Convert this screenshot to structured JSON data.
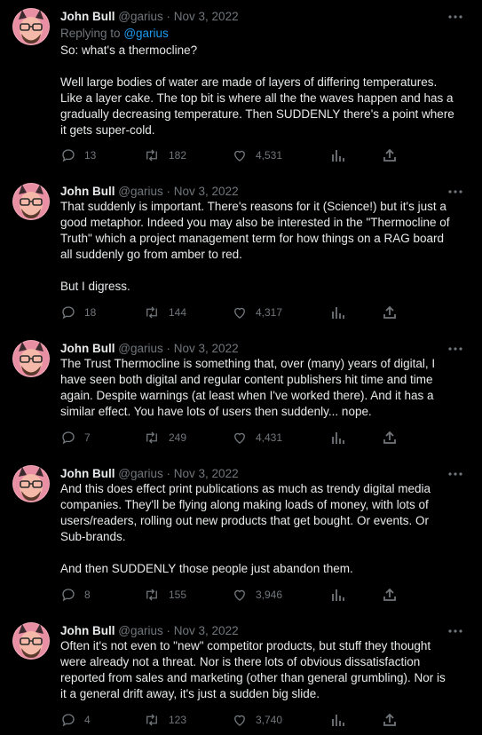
{
  "colors": {
    "background": "#000000",
    "text_primary": "#e7e9ea",
    "text_secondary": "#71767b",
    "link": "#1d9bf0"
  },
  "tweets": [
    {
      "author": "John Bull",
      "handle": "@garius",
      "separator": "·",
      "date": "Nov 3, 2022",
      "replying_label": "Replying to",
      "replying_handle": "@garius",
      "paragraphs": [
        [
          "So: what's a thermocline?"
        ],
        [
          "Well large bodies of water are made of layers of differing temperatures.",
          "Like a layer cake. The top bit is where all the the waves happen and has a",
          "gradually decreasing temperature. Then SUDDENLY there's a point where",
          "it gets super-cold."
        ]
      ],
      "replies": "13",
      "retweets": "182",
      "likes": "4,531"
    },
    {
      "author": "John Bull",
      "handle": "@garius",
      "separator": "·",
      "date": "Nov 3, 2022",
      "paragraphs": [
        [
          "That suddenly is important. There's reasons for it (Science!) but it's just a",
          "good metaphor. Indeed you may also be interested in the \"Thermocline of",
          "Truth\" which a project management term for how things on a RAG board",
          "all suddenly go from amber to red."
        ],
        [
          "But I digress."
        ]
      ],
      "replies": "18",
      "retweets": "144",
      "likes": "4,317"
    },
    {
      "author": "John Bull",
      "handle": "@garius",
      "separator": "·",
      "date": "Nov 3, 2022",
      "paragraphs": [
        [
          "The Trust Thermocline is something that, over (many) years of digital, I",
          "have seen both digital and regular content publishers hit time and time",
          "again. Despite warnings (at least when I've worked there). And it has a",
          "similar effect. You have lots of users then suddenly... nope."
        ]
      ],
      "replies": "7",
      "retweets": "249",
      "likes": "4,431"
    },
    {
      "author": "John Bull",
      "handle": "@garius",
      "separator": "·",
      "date": "Nov 3, 2022",
      "paragraphs": [
        [
          "And this does effect print publications as much as trendy digital media",
          "companies. They'll be flying along making loads of money, with lots of",
          "users/readers, rolling out new products that get bought. Or events. Or",
          "Sub-brands."
        ],
        [
          "And then SUDDENLY those people just abandon them."
        ]
      ],
      "replies": "8",
      "retweets": "155",
      "likes": "3,946"
    },
    {
      "author": "John Bull",
      "handle": "@garius",
      "separator": "·",
      "date": "Nov 3, 2022",
      "paragraphs": [
        [
          "Often it's not even to \"new\" competitor products, but stuff they thought",
          "were already not a threat. Nor is there lots of obvious dissatisfaction",
          "reported from sales and marketing (other than general grumbling). Nor is",
          "it a general drift away, it's just a sudden big slide."
        ]
      ],
      "replies": "4",
      "retweets": "123",
      "likes": "3,740"
    }
  ]
}
